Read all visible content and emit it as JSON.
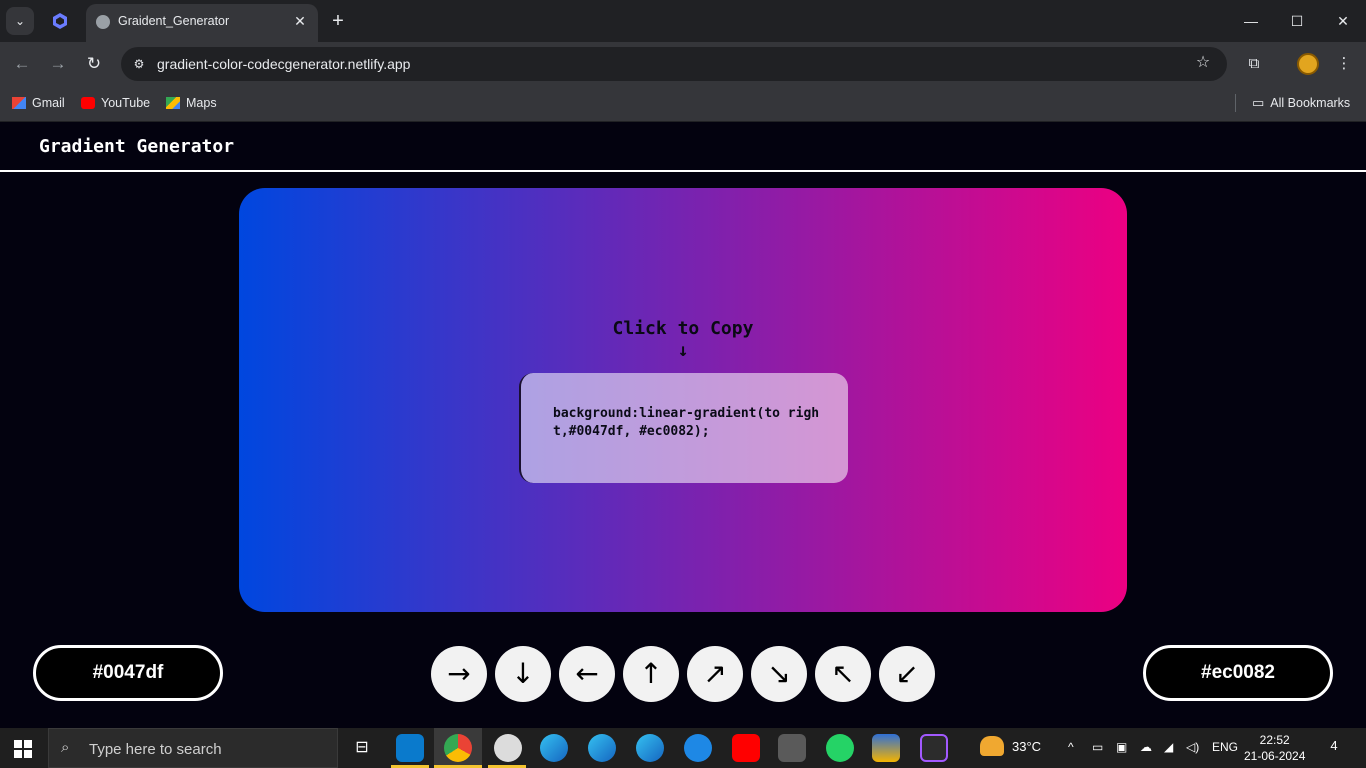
{
  "browser": {
    "tab_title": "Graident_Generator",
    "url": "gradient-color-codecgenerator.netlify.app",
    "bookmarks": [
      "Gmail",
      "YouTube",
      "Maps"
    ],
    "all_bookmarks": "All Bookmarks"
  },
  "app": {
    "title": "Gradient Generator",
    "copy_hint": "Click to Copy",
    "copy_arrow": "↓",
    "css_code": "background:linear-gradient(to right,#0047df, #ec0082);",
    "color1": "#0047df",
    "color2": "#ec0082",
    "gradient_direction": "to right",
    "directions": [
      "→",
      "↓",
      "←",
      "↑",
      "↗",
      "↘",
      "↖",
      "↙"
    ]
  },
  "taskbar": {
    "search_placeholder": "Type here to search",
    "weather": "33°C",
    "language": "ENG",
    "time": "22:52",
    "date": "21-06-2024",
    "notifications": "4"
  }
}
